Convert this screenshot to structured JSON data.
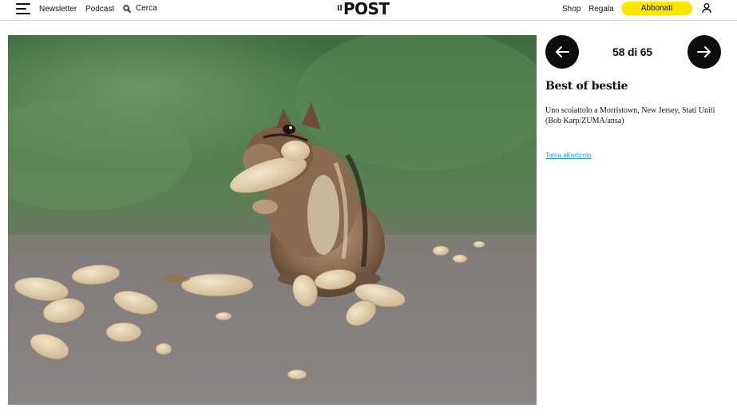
{
  "header": {
    "nav": {
      "newsletter": "Newsletter",
      "podcast": "Podcast",
      "search": "Cerca"
    },
    "logo": {
      "prefix": "il",
      "name": "POST"
    },
    "right": {
      "shop": "Shop",
      "regala": "Regala",
      "abbonati": "Abbonati"
    },
    "icons": [
      "menu-icon",
      "search-icon",
      "user-icon"
    ],
    "accent_color": "#ffe500"
  },
  "gallery": {
    "counter": "58 di 65",
    "current": 58,
    "total": 65,
    "title": "Best of bestie",
    "caption_line1": "Uno scoiattolo a Morristown, New Jersey, Stati Uniti",
    "caption_line2": "(Bob Karp/ZUMA/ansa)",
    "back_link": "Torna all'articolo",
    "link_color": "#1a9ad8",
    "nav_icons": [
      "arrow-left-icon",
      "arrow-right-icon"
    ]
  }
}
